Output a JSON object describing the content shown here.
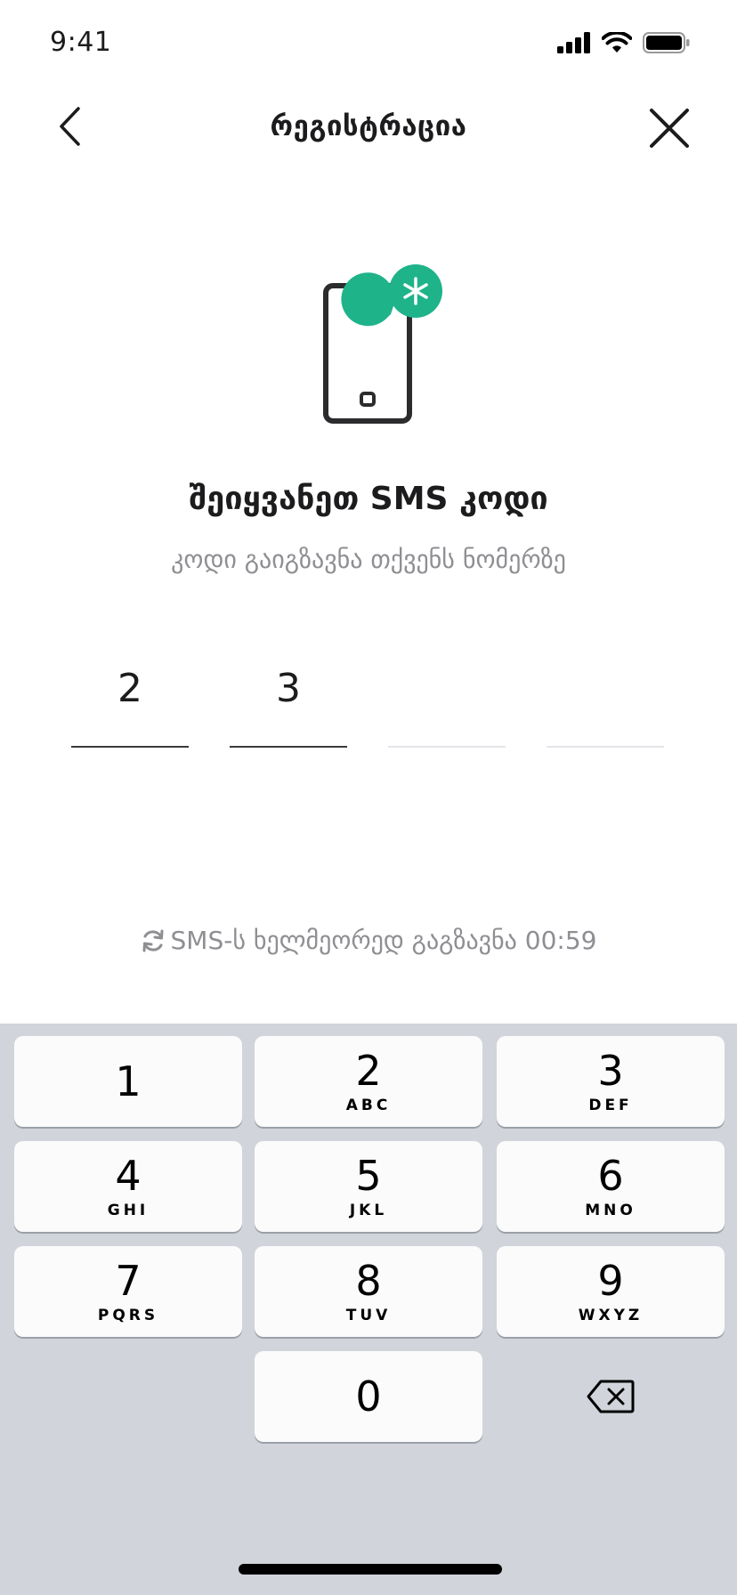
{
  "status_bar": {
    "time": "9:41"
  },
  "nav": {
    "title": "რეგისტრაცია"
  },
  "content": {
    "headline": "შეიყვანეთ SMS კოდი",
    "subline": "კოდი გაიგზავნა თქვენს ნომერზე"
  },
  "code": {
    "digits": [
      "2",
      "3",
      "",
      ""
    ]
  },
  "resend": {
    "text": "SMS-ს ხელმეორედ გაგზავნა 00:59"
  },
  "keypad": {
    "keys": [
      {
        "num": "1",
        "letters": ""
      },
      {
        "num": "2",
        "letters": "ABC"
      },
      {
        "num": "3",
        "letters": "DEF"
      },
      {
        "num": "4",
        "letters": "GHI"
      },
      {
        "num": "5",
        "letters": "JKL"
      },
      {
        "num": "6",
        "letters": "MNO"
      },
      {
        "num": "7",
        "letters": "PQRS"
      },
      {
        "num": "8",
        "letters": "TUV"
      },
      {
        "num": "9",
        "letters": "WXYZ"
      },
      {
        "num": "0",
        "letters": ""
      }
    ]
  },
  "colors": {
    "accent": "#1fb38a",
    "keypad_bg": "#d1d4da",
    "muted_text": "#8e8e93"
  },
  "icons": [
    "back-chevron-icon",
    "close-icon",
    "phone-sms-icon",
    "refresh-icon",
    "backspace-icon",
    "signal-icon",
    "wifi-icon",
    "battery-icon"
  ]
}
